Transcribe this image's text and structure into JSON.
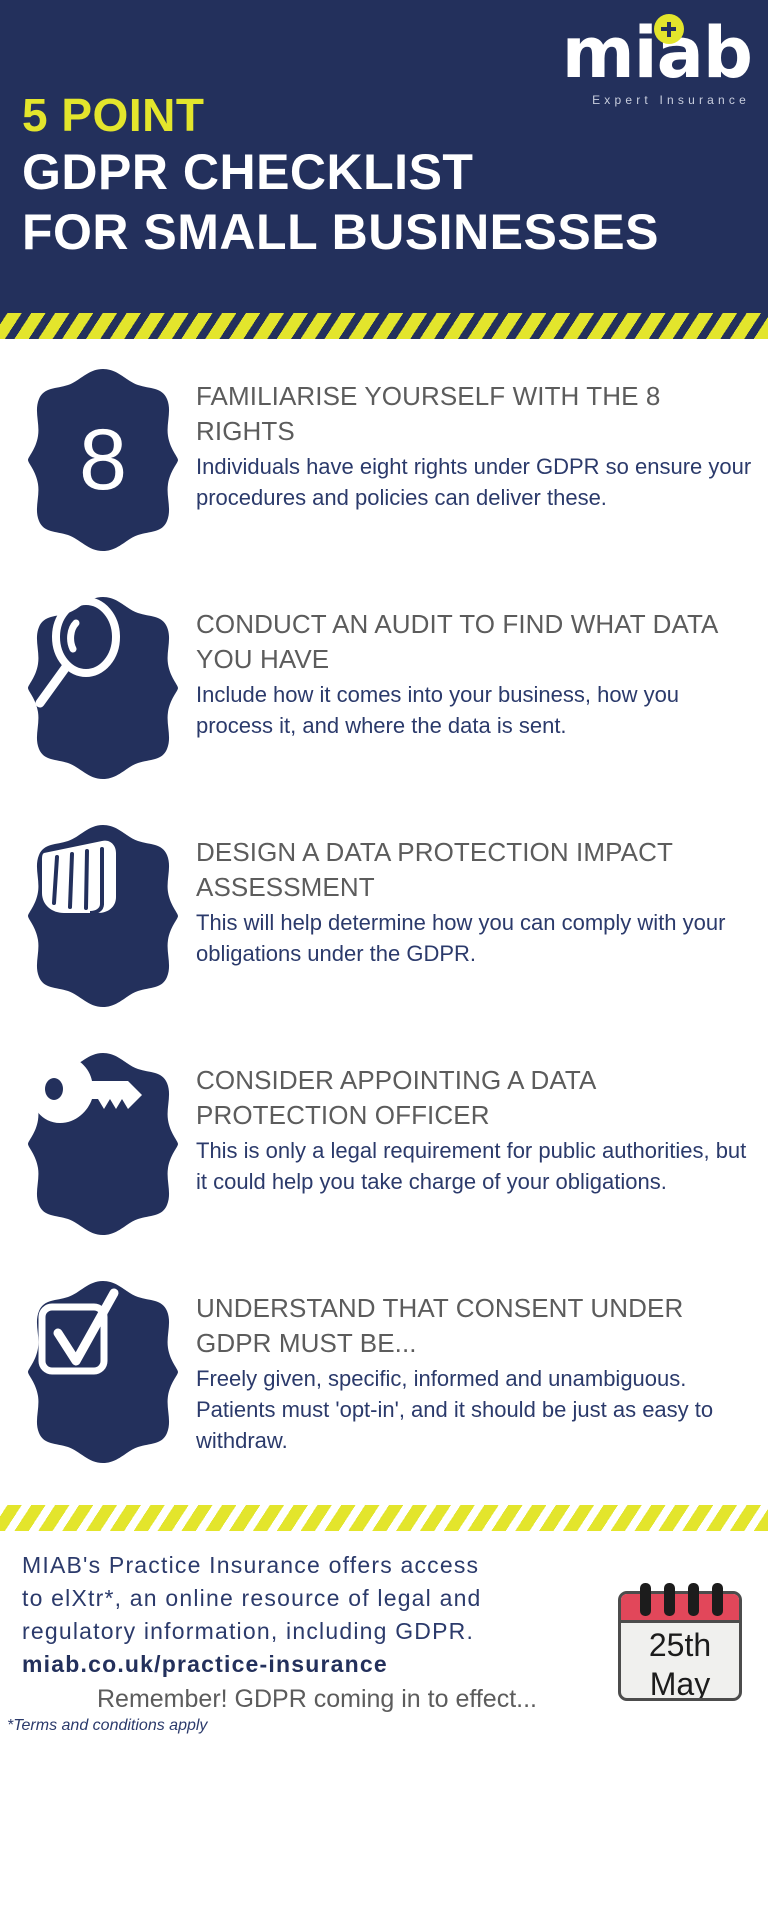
{
  "header": {
    "logo": {
      "wordmark": "miab",
      "tagline": "Expert  Insurance",
      "dot_icon": "plus-in-circle-icon"
    },
    "title_line1": "5 POINT",
    "title_line2": "GDPR CHECKLIST",
    "title_line3": "FOR SMALL BUSINESSES"
  },
  "colors": {
    "navy": "#23305c",
    "yellow": "#e3e52c",
    "body_text": "#2b3a6b",
    "heading_text": "#5c5c5c",
    "calendar_red": "#e2475a"
  },
  "items": [
    {
      "icon": "number-eight-badge",
      "badge_number": "8",
      "heading": "FAMILIARISE YOURSELF WITH THE 8 RIGHTS",
      "body": "Individuals have eight rights under GDPR so ensure your procedures and policies can deliver these."
    },
    {
      "icon": "magnifying-glass-icon",
      "badge_number": "",
      "heading": "CONDUCT AN AUDIT TO FIND WHAT DATA YOU HAVE",
      "body": "Include how it comes into your business, how you process it, and where the data is sent."
    },
    {
      "icon": "fist-icon",
      "badge_number": "",
      "heading": "DESIGN A DATA PROTECTION IMPACT ASSESSMENT",
      "body": "This will help determine how you can comply with your obligations under the GDPR."
    },
    {
      "icon": "key-icon",
      "badge_number": "",
      "heading": "CONSIDER APPOINTING A DATA PROTECTION OFFICER",
      "body": "This is only a legal requirement for public authorities, but it could help you take charge of your obligations."
    },
    {
      "icon": "checkbox-tick-icon",
      "badge_number": "",
      "heading": "UNDERSTAND THAT CONSENT UNDER GDPR MUST BE...",
      "body": "Freely given, specific, informed and unambiguous. Patients must 'opt-in', and it should be just as easy to withdraw."
    }
  ],
  "footer": {
    "line1": "MIAB's Practice Insurance offers access",
    "line2": "to elXtr*, an online resource of legal and",
    "line3": "regulatory information, including GDPR.",
    "url": "miab.co.uk/practice-insurance",
    "remember": "Remember! GDPR coming in to effect...",
    "terms": "*Terms and conditions apply",
    "calendar": {
      "icon": "calendar-icon",
      "day": "25th",
      "month": "May"
    }
  }
}
